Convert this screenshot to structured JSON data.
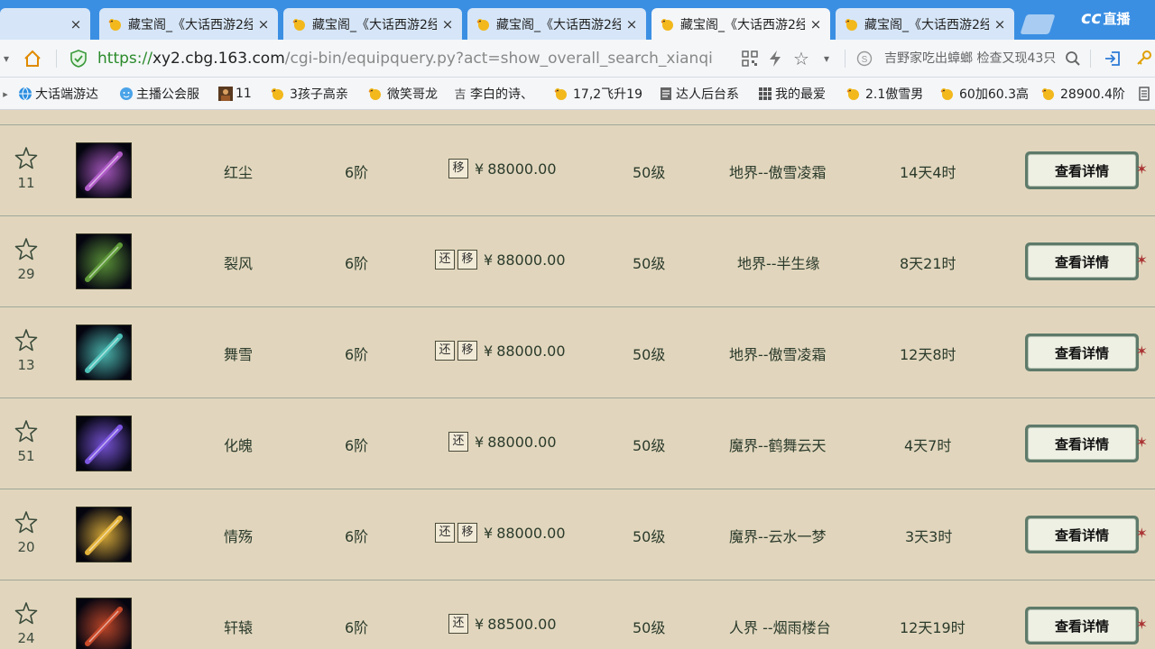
{
  "tabs": [
    {
      "title": "",
      "active": false
    },
    {
      "title": "藏宝阁_《大话西游2经",
      "active": false
    },
    {
      "title": "藏宝阁_《大话西游2经",
      "active": false
    },
    {
      "title": "藏宝阁_《大话西游2经",
      "active": false
    },
    {
      "title": "藏宝阁_《大话西游2经",
      "active": true
    },
    {
      "title": "藏宝阁_《大话西游2经",
      "active": false
    }
  ],
  "tab_close_glyph": "×",
  "cc_logo": {
    "mark": "cc",
    "text": "直播"
  },
  "address": {
    "scheme": "https://",
    "host": "xy2.cbg.163.com",
    "path": "/cgi-bin/equipquery.py?act=show_overall_search_xianqi",
    "search_hint": "吉野家吃出蟑螂 检查又现43只"
  },
  "bookmarks": [
    {
      "label": "大话端游达",
      "icon": "globe-icon"
    },
    {
      "label": "主播公会服",
      "icon": "face-icon"
    },
    {
      "label": "11",
      "icon": "avatar-icon"
    },
    {
      "label": "3孩子高亲",
      "icon": "chick-icon"
    },
    {
      "label": "微笑哥龙",
      "icon": "chick-icon"
    },
    {
      "label": "李白的诗、",
      "icon": "glyph-icon"
    },
    {
      "label": "17,2飞升19",
      "icon": "chick-icon"
    },
    {
      "label": "达人后台系",
      "icon": "page-icon"
    },
    {
      "label": "我的最爱",
      "icon": "grid-icon"
    },
    {
      "label": "2.1傲雪男",
      "icon": "chick-icon"
    },
    {
      "label": "60加60.3高",
      "icon": "chick-icon"
    },
    {
      "label": "28900.4阶",
      "icon": "chick-icon"
    }
  ],
  "badge_labels": {
    "huan": "还",
    "yi": "移"
  },
  "currency": "¥",
  "detail_label": "查看详情",
  "items": [
    {
      "fav_count": "11",
      "name": "红尘",
      "tier": "6阶",
      "badges": [
        "yi"
      ],
      "price": "88000.00",
      "level": "50级",
      "server": "地界--傲雪凌霜",
      "time_left": "14天4时",
      "thumb_color": "#b05cc8"
    },
    {
      "fav_count": "29",
      "name": "裂风",
      "tier": "6阶",
      "badges": [
        "huan",
        "yi"
      ],
      "price": "88000.00",
      "level": "50级",
      "server": "地界--半生缘",
      "time_left": "8天21时",
      "thumb_color": "#5f9a3a"
    },
    {
      "fav_count": "13",
      "name": "舞雪",
      "tier": "6阶",
      "badges": [
        "huan",
        "yi"
      ],
      "price": "88000.00",
      "level": "50级",
      "server": "地界--傲雪凌霜",
      "time_left": "12天8时",
      "thumb_color": "#4fc0b8"
    },
    {
      "fav_count": "51",
      "name": "化魄",
      "tier": "6阶",
      "badges": [
        "huan"
      ],
      "price": "88000.00",
      "level": "50级",
      "server": "魔界--鹤舞云天",
      "time_left": "4天7时",
      "thumb_color": "#7d57e0"
    },
    {
      "fav_count": "20",
      "name": "情殇",
      "tier": "6阶",
      "badges": [
        "huan",
        "yi"
      ],
      "price": "88000.00",
      "level": "50级",
      "server": "魔界--云水一梦",
      "time_left": "3天3时",
      "thumb_color": "#e2b23a"
    },
    {
      "fav_count": "24",
      "name": "轩辕",
      "tier": "6阶",
      "badges": [
        "huan"
      ],
      "price": "88500.00",
      "level": "50级",
      "server": "人界 --烟雨楼台",
      "time_left": "12天19时",
      "thumb_color": "#c84a2a"
    }
  ]
}
